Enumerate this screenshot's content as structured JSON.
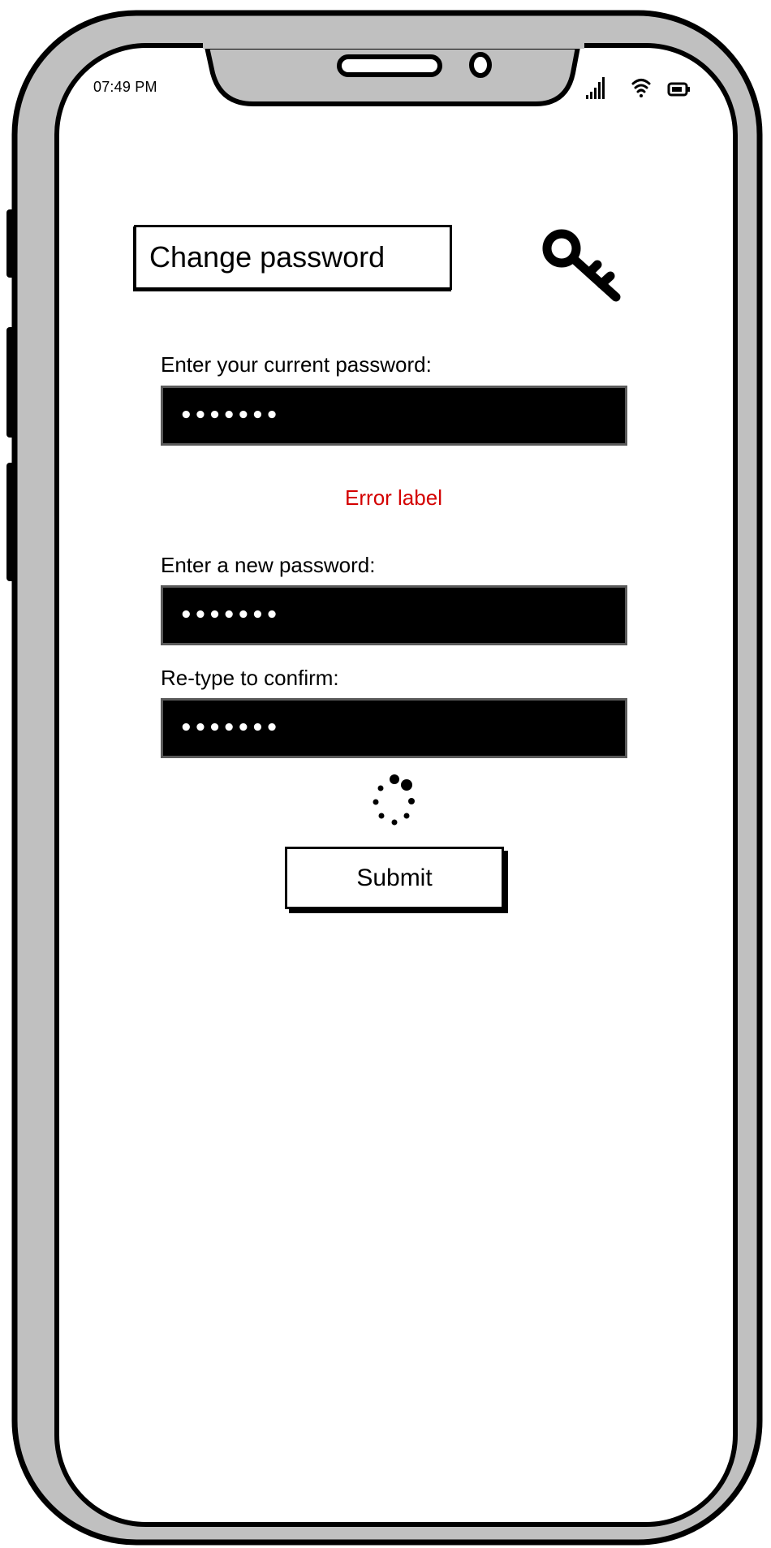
{
  "status_bar": {
    "time": "07:49 PM",
    "icons": [
      "signal-icon",
      "wifi-icon",
      "battery-icon"
    ]
  },
  "header": {
    "title": "Change password",
    "icon": "key-icon"
  },
  "form": {
    "current_label": "Enter your current password:",
    "current_value": "•••••••",
    "error_text": "Error label",
    "new_label": "Enter a new password:",
    "new_value": "•••••••",
    "confirm_label": "Re-type to confirm:",
    "confirm_value": "•••••••",
    "loading_icon": "spinner-icon",
    "submit_label": "Submit"
  },
  "colors": {
    "phone_frame": "#c0c0c0",
    "field_background": "#000000",
    "error_text": "#d40000"
  }
}
